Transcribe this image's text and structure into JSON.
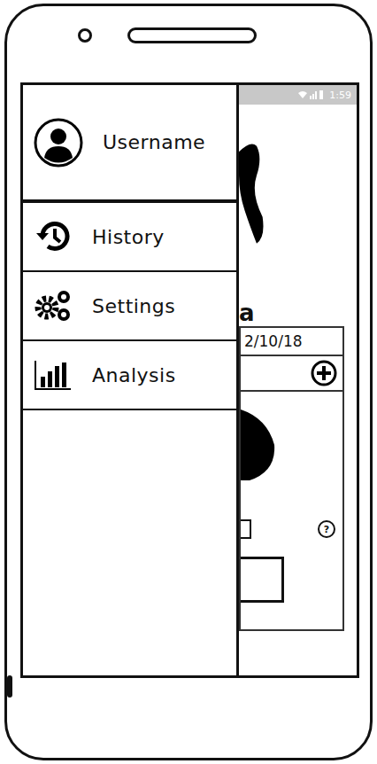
{
  "status_bar": {
    "time": "1:59"
  },
  "drawer": {
    "items": [
      {
        "label": "Username",
        "kind": "profile"
      },
      {
        "label": "History",
        "kind": "link"
      },
      {
        "label": "Settings",
        "kind": "link"
      },
      {
        "label": "Analysis",
        "kind": "link"
      }
    ]
  },
  "background": {
    "heading": "a",
    "entry": {
      "date": "2/10/18",
      "help": "?"
    }
  }
}
